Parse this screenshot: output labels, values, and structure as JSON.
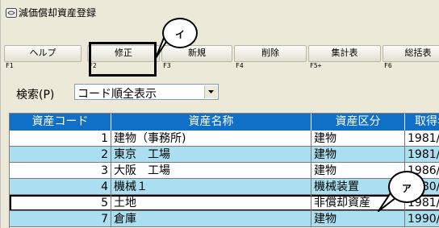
{
  "window": {
    "title": "減価償却資産登録"
  },
  "toolbar": {
    "buttons": [
      {
        "label": "ヘルプ",
        "key": "F1"
      },
      {
        "label": "修正",
        "key": "F2"
      },
      {
        "label": "新規",
        "key": "F3"
      },
      {
        "label": "削除",
        "key": "F4"
      },
      {
        "label": "集計表",
        "key": "F5+"
      },
      {
        "label": "総括表",
        "key": "F6"
      }
    ]
  },
  "search": {
    "label": "検索(P)",
    "value": "コード順全表示"
  },
  "table": {
    "columns": [
      "資産コード",
      "資産名称",
      "資産区分",
      "取得年"
    ],
    "rows": [
      {
        "code": "1",
        "name": "建物（事務所)",
        "category": "建物",
        "acquired": "1981/"
      },
      {
        "code": "2",
        "name": "東京　工場",
        "category": "建物",
        "acquired": "1981/"
      },
      {
        "code": "3",
        "name": "大阪　工場",
        "category": "建物",
        "acquired": "1986/"
      },
      {
        "code": "4",
        "name": "機械１",
        "category": "機械装置",
        "acquired": "1980/"
      },
      {
        "code": "5",
        "name": "土地",
        "category": "非償却資産",
        "acquired": "1981/"
      },
      {
        "code": "7",
        "name": "倉庫",
        "category": "建物",
        "acquired": "1990/"
      }
    ],
    "selected_row_index": 4,
    "colors": {
      "header": "#1070c8",
      "alt_row": "#a9dff1"
    }
  },
  "callouts": {
    "i": "イ",
    "a": "ア"
  }
}
